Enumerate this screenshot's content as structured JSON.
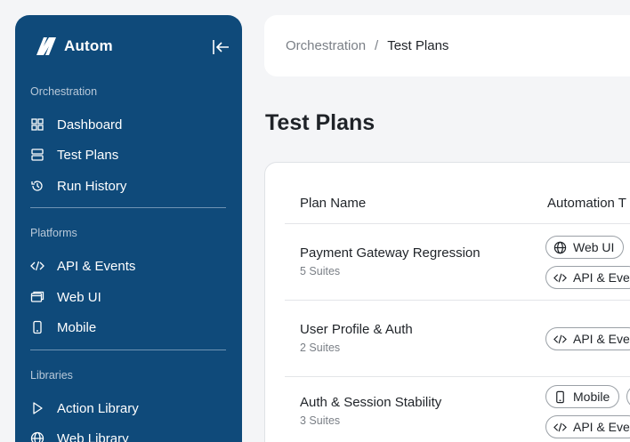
{
  "brand": {
    "name": "Autom"
  },
  "sidebar": {
    "sections": [
      {
        "label": "Orchestration"
      },
      {
        "label": "Platforms"
      },
      {
        "label": "Libraries"
      }
    ],
    "items": [
      {
        "label": "Dashboard",
        "icon": "grid-icon"
      },
      {
        "label": "Test Plans",
        "icon": "server-icon"
      },
      {
        "label": "Run History",
        "icon": "history-icon"
      },
      {
        "label": "API & Events",
        "icon": "code-icon"
      },
      {
        "label": "Web UI",
        "icon": "browser-window-icon"
      },
      {
        "label": "Mobile",
        "icon": "mobile-icon"
      },
      {
        "label": "Action Library",
        "icon": "play-icon"
      },
      {
        "label": "Web Library",
        "icon": "globe-icon"
      }
    ]
  },
  "breadcrumb": {
    "parent": "Orchestration",
    "separator": "/",
    "current": "Test Plans"
  },
  "page": {
    "title": "Test Plans"
  },
  "table": {
    "columns": [
      "Plan Name",
      "Automation T"
    ],
    "rows": [
      {
        "name": "Payment Gateway Regression",
        "suites": "5 Suites",
        "chips": [
          "Web UI",
          "API & Eve"
        ]
      },
      {
        "name": "User Profile & Auth",
        "suites": "2 Suites",
        "chips": [
          "API & Eve"
        ]
      },
      {
        "name": "Auth & Session Stability",
        "suites": "3 Suites",
        "chips": [
          "Mobile",
          "API & Eve"
        ]
      }
    ]
  },
  "colors": {
    "sidebar": "#0f4a7a",
    "background": "#f4f5f7",
    "card": "#ffffff"
  }
}
